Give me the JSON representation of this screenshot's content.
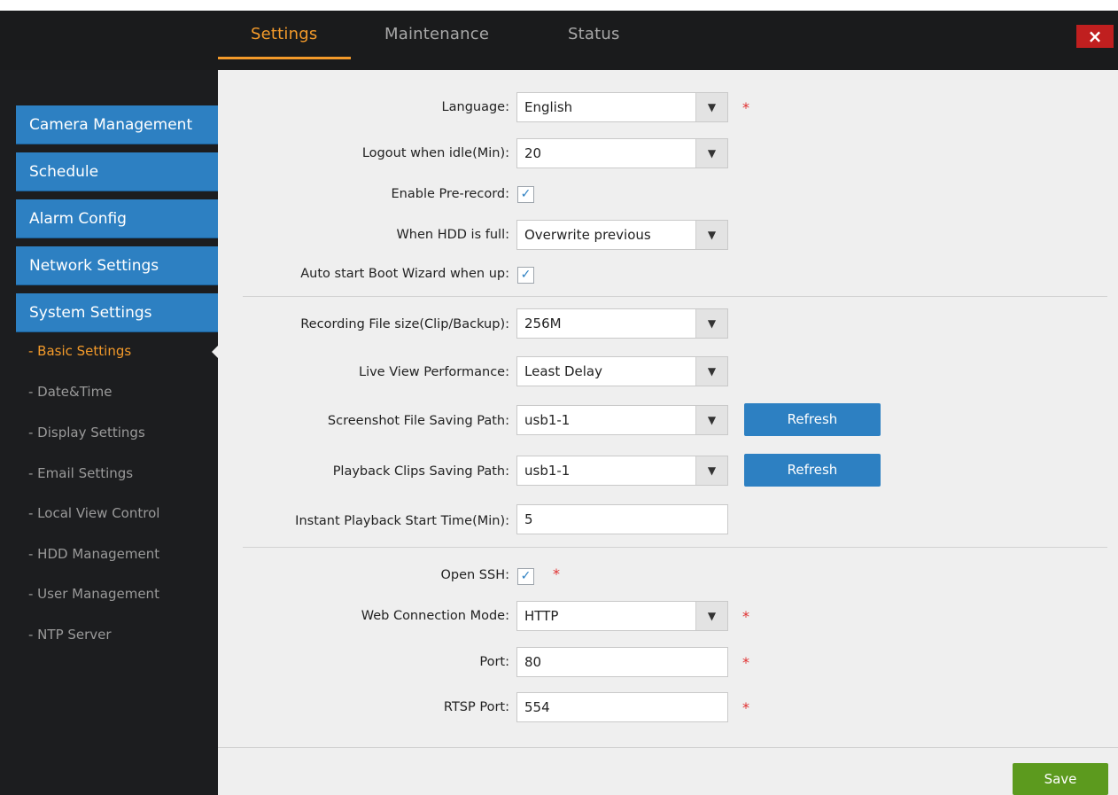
{
  "topbar": {
    "tabs": [
      {
        "label": "Settings"
      },
      {
        "label": "Maintenance"
      },
      {
        "label": "Status"
      }
    ],
    "close_label": "×"
  },
  "sidebar": {
    "sections": [
      {
        "label": "Camera Management"
      },
      {
        "label": "Schedule"
      },
      {
        "label": "Alarm Config"
      },
      {
        "label": "Network Settings"
      },
      {
        "label": "System Settings"
      }
    ],
    "sub_items": [
      {
        "label": "- Basic Settings"
      },
      {
        "label": "- Date&Time"
      },
      {
        "label": "- Display Settings"
      },
      {
        "label": "- Email Settings"
      },
      {
        "label": "- Local View Control"
      },
      {
        "label": "- HDD Management"
      },
      {
        "label": "- User Management"
      },
      {
        "label": "- NTP Server"
      }
    ]
  },
  "form": {
    "language": {
      "label": "Language:",
      "value": "English"
    },
    "logout_idle": {
      "label": "Logout when idle(Min):",
      "value": "20"
    },
    "pre_record": {
      "label": "Enable Pre-record:"
    },
    "hdd_full": {
      "label": "When HDD is full:",
      "value": "Overwrite previous"
    },
    "boot_wizard": {
      "label": "Auto start Boot Wizard when up:"
    },
    "file_size": {
      "label": "Recording File size(Clip/Backup):",
      "value": "256M"
    },
    "live_view": {
      "label": "Live View Performance:",
      "value": "Least Delay"
    },
    "screenshot_path": {
      "label": "Screenshot File Saving Path:",
      "value": "usb1-1"
    },
    "playback_path": {
      "label": "Playback Clips Saving Path:",
      "value": "usb1-1"
    },
    "instant_playback": {
      "label": "Instant Playback Start Time(Min):",
      "value": "5"
    },
    "ssh": {
      "label": "Open SSH:"
    },
    "web_mode": {
      "label": "Web Connection Mode:",
      "value": "HTTP"
    },
    "port": {
      "label": "Port:",
      "value": "80"
    },
    "rtsp_port": {
      "label": "RTSP Port:",
      "value": "554"
    },
    "refresh_label": "Refresh",
    "required_mark": "*",
    "check_mark": "✓",
    "arrow_glyph": "▼"
  },
  "footer": {
    "save_label": "Save"
  },
  "colors": {
    "accent": "#f39a2a",
    "sidebar_button": "#2d80c2",
    "save_button": "#5c9a1e",
    "close_button": "#c01f1f",
    "required": "#e03030"
  }
}
